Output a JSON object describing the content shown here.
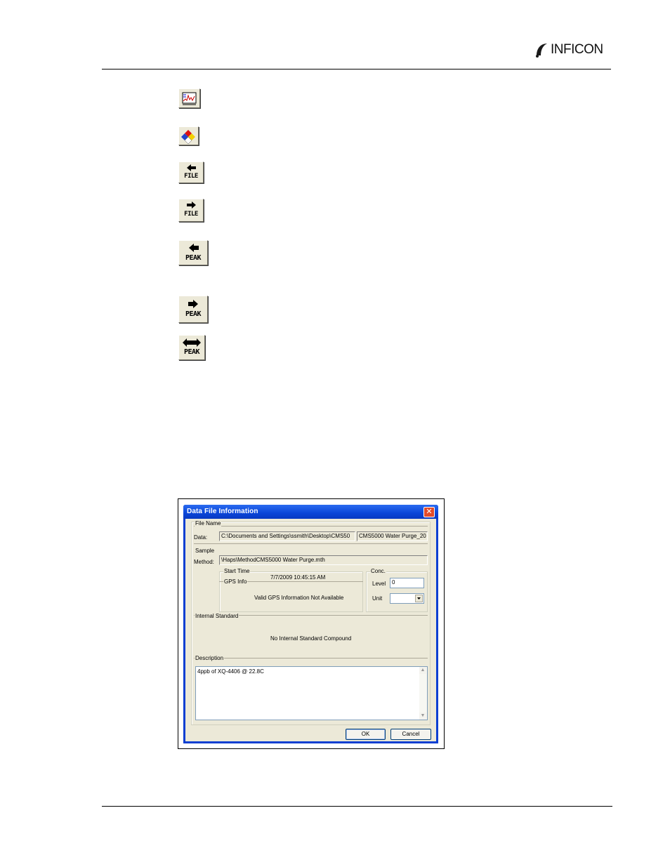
{
  "header": {
    "brand": "INFICON"
  },
  "toolbar_icons": [
    {
      "name": "spectrum-view-icon",
      "label": ""
    },
    {
      "name": "hazard-diamond-icon",
      "label": ""
    },
    {
      "name": "previous-file-icon",
      "label": "FILE"
    },
    {
      "name": "next-file-icon",
      "label": "FILE"
    },
    {
      "name": "previous-peak-icon",
      "label": "PEAK"
    },
    {
      "name": "next-peak-icon",
      "label": "PEAK"
    },
    {
      "name": "peak-range-icon",
      "label": "PEAK"
    }
  ],
  "dialog": {
    "title": "Data File Information",
    "close_glyph": "✕",
    "file_name": {
      "group_label": "File Name",
      "data_label": "Data:",
      "data_path": "C:\\Documents and Settings\\ssmith\\Desktop\\CMS50",
      "data_file": "CMS5000 Water Purge_20"
    },
    "sample": {
      "group_label": "Sample",
      "method_label": "Method:",
      "method_value": "\\Haps\\MethodCMS5000 Water Purge.mth",
      "start_time_label": "Start Time",
      "start_time_value": "7/7/2009 10:45:15 AM",
      "gps_label": "GPS Info",
      "gps_value": "Valid GPS Information Not Available",
      "conc_label": "Conc.",
      "level_label": "Level",
      "level_value": "0",
      "unit_label": "Unit",
      "unit_value": ""
    },
    "internal_standard": {
      "group_label": "Internal Standard",
      "value": "No Internal Standard Compound"
    },
    "description": {
      "group_label": "Description",
      "value": "4ppb of XQ-4406 @ 22.8C"
    },
    "buttons": {
      "ok": "OK",
      "cancel": "Cancel"
    }
  }
}
